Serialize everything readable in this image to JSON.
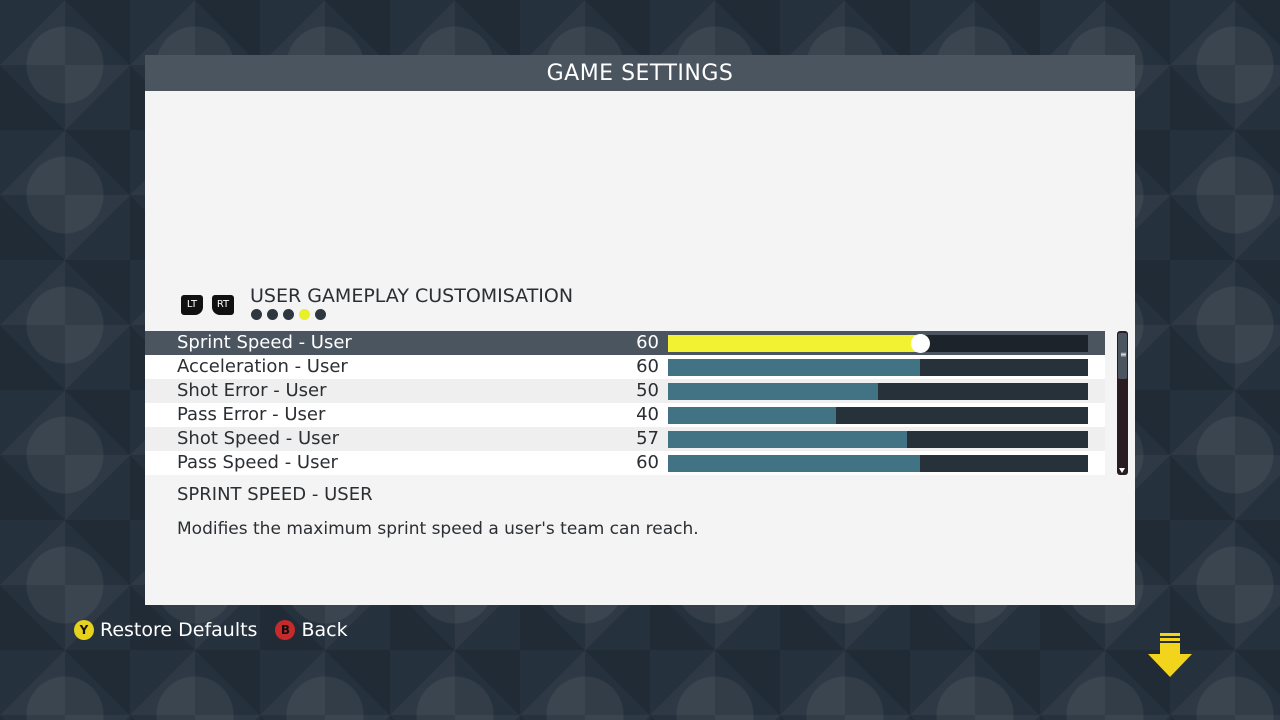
{
  "header": {
    "title": "GAME SETTINGS"
  },
  "section": {
    "title": "USER GAMEPLAY CUSTOMISATION",
    "lt_label": "LT",
    "rt_label": "RT",
    "page_dots": 5,
    "active_page": 4
  },
  "settings": [
    {
      "label": "Sprint Speed - User",
      "value": "60",
      "level": 60,
      "selected": true
    },
    {
      "label": "Acceleration - User",
      "value": "60",
      "level": 60,
      "selected": false
    },
    {
      "label": "Shot Error - User",
      "value": "50",
      "level": 50,
      "selected": false
    },
    {
      "label": "Pass Error - User",
      "value": "40",
      "level": 40,
      "selected": false
    },
    {
      "label": "Shot Speed - User",
      "value": "57",
      "level": 57,
      "selected": false
    },
    {
      "label": "Pass Speed - User",
      "value": "60",
      "level": 60,
      "selected": false
    }
  ],
  "slider_max": 100,
  "description": {
    "title": "SPRINT SPEED - USER",
    "text": "Modifies the maximum sprint speed a user's team can reach."
  },
  "footer": {
    "restore": {
      "glyph": "Y",
      "label": "Restore Defaults"
    },
    "back": {
      "glyph": "B",
      "label": "Back"
    }
  },
  "colors": {
    "highlight": "#f2f233",
    "bar_fill": "#417384",
    "header_bg": "#4b5560",
    "y_button": "#e6d21c",
    "b_button": "#c62a2a"
  }
}
